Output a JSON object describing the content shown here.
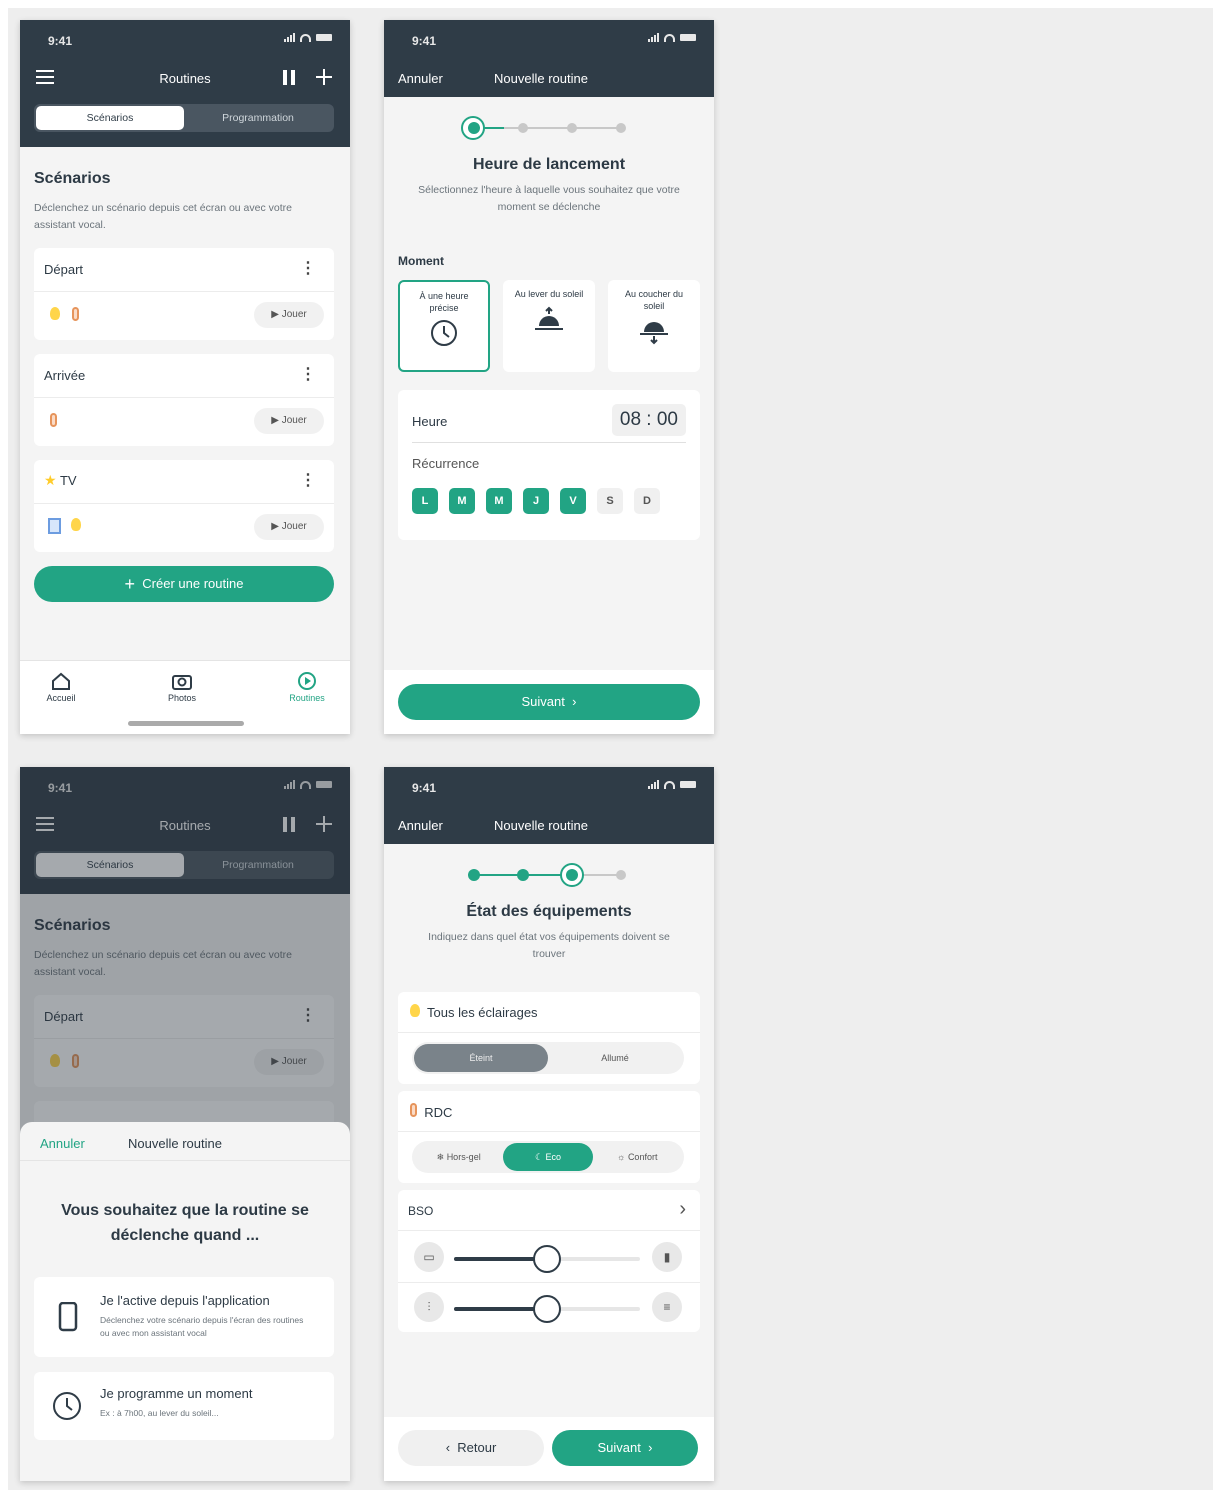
{
  "status_time": "9:41",
  "screen1": {
    "title": "Routines",
    "tabs": [
      "Scénarios",
      "Programmation"
    ],
    "section_title": "Scénarios",
    "section_desc": "Déclenchez un scénario depuis cet écran ou avec votre assistant vocal.",
    "cards": [
      {
        "name": "Départ",
        "play": "Jouer"
      },
      {
        "name": "Arrivée",
        "play": "Jouer"
      },
      {
        "name": "TV",
        "play": "Jouer"
      }
    ],
    "create_label": "Créer une routine",
    "nav": [
      "Accueil",
      "Photos",
      "Routines"
    ]
  },
  "screen2": {
    "cancel": "Annuler",
    "title": "Nouvelle routine",
    "heading": "Heure de lancement",
    "desc": "Sélectionnez l'heure à laquelle vous souhaitez que votre moment se déclenche",
    "moment_label": "Moment",
    "options": [
      "À une heure précise",
      "Au lever du soleil",
      "Au coucher du soleil"
    ],
    "hour_label": "Heure",
    "hour_value": "08 : 00",
    "recurrence_label": "Récurrence",
    "days": [
      "L",
      "M",
      "M",
      "J",
      "V",
      "S",
      "D"
    ],
    "next": "Suivant"
  },
  "screen3": {
    "title": "Routines",
    "tabs": [
      "Scénarios",
      "Programmation"
    ],
    "section_title": "Scénarios",
    "section_desc": "Déclenchez un scénario depuis cet écran ou avec votre assistant vocal.",
    "card": {
      "name": "Départ",
      "play": "Jouer"
    },
    "sheet_cancel": "Annuler",
    "sheet_title": "Nouvelle routine",
    "question": "Vous souhaitez que la routine se déclenche quand ...",
    "option1_title": "Je l'active depuis l'application",
    "option1_desc": "Déclenchez votre scénario depuis l'écran des routines ou avec mon assistant vocal",
    "option2_title": "Je programme un moment",
    "option2_desc": "Ex : à 7h00, au lever du soleil..."
  },
  "screen4": {
    "cancel": "Annuler",
    "title": "Nouvelle routine",
    "heading": "État des équipements",
    "desc": "Indiquez dans quel état vos équipements doivent se trouver",
    "lights_label": "Tous les éclairages",
    "lights_toggle": [
      "Éteint",
      "Allumé"
    ],
    "rdc_label": "RDC",
    "rdc_modes": [
      "Hors-gel",
      "Eco",
      "Confort"
    ],
    "bso_label": "BSO",
    "slider1": 0.5,
    "slider2": 0.5,
    "back": "Retour",
    "next": "Suivant"
  },
  "colors": {
    "header": "#2f3c47",
    "accent": "#22a484"
  }
}
